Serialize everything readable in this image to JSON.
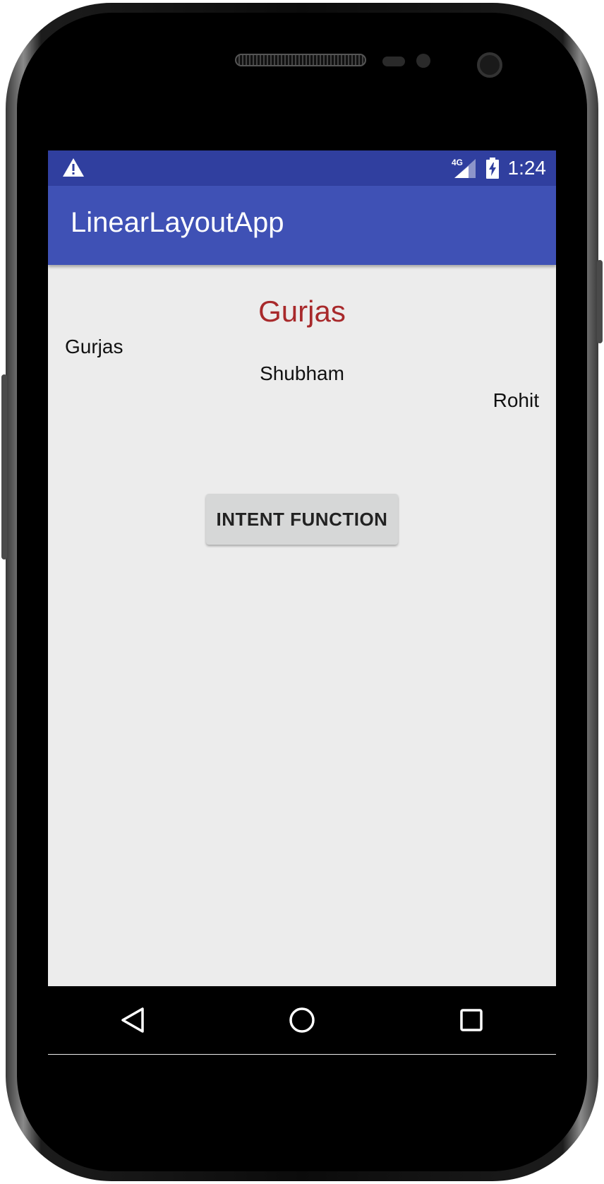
{
  "status_bar": {
    "time": "1:24",
    "network": "4G",
    "icons": [
      "warning-icon",
      "signal-icon",
      "battery-charging-icon"
    ]
  },
  "app_bar": {
    "title": "LinearLayoutApp"
  },
  "content": {
    "heading": "Gurjas",
    "left_text": "Gurjas",
    "center_text": "Shubham",
    "right_text": "Rohit",
    "button_label": "INTENT FUNCTION"
  },
  "nav_bar": {
    "icons": [
      "back-icon",
      "home-icon",
      "recents-icon"
    ]
  },
  "colors": {
    "status_bar": "#303f9f",
    "app_bar": "#3f51b5",
    "heading_text": "#a8292b",
    "screen_bg": "#ececec",
    "button_bg": "#d6d7d7"
  }
}
